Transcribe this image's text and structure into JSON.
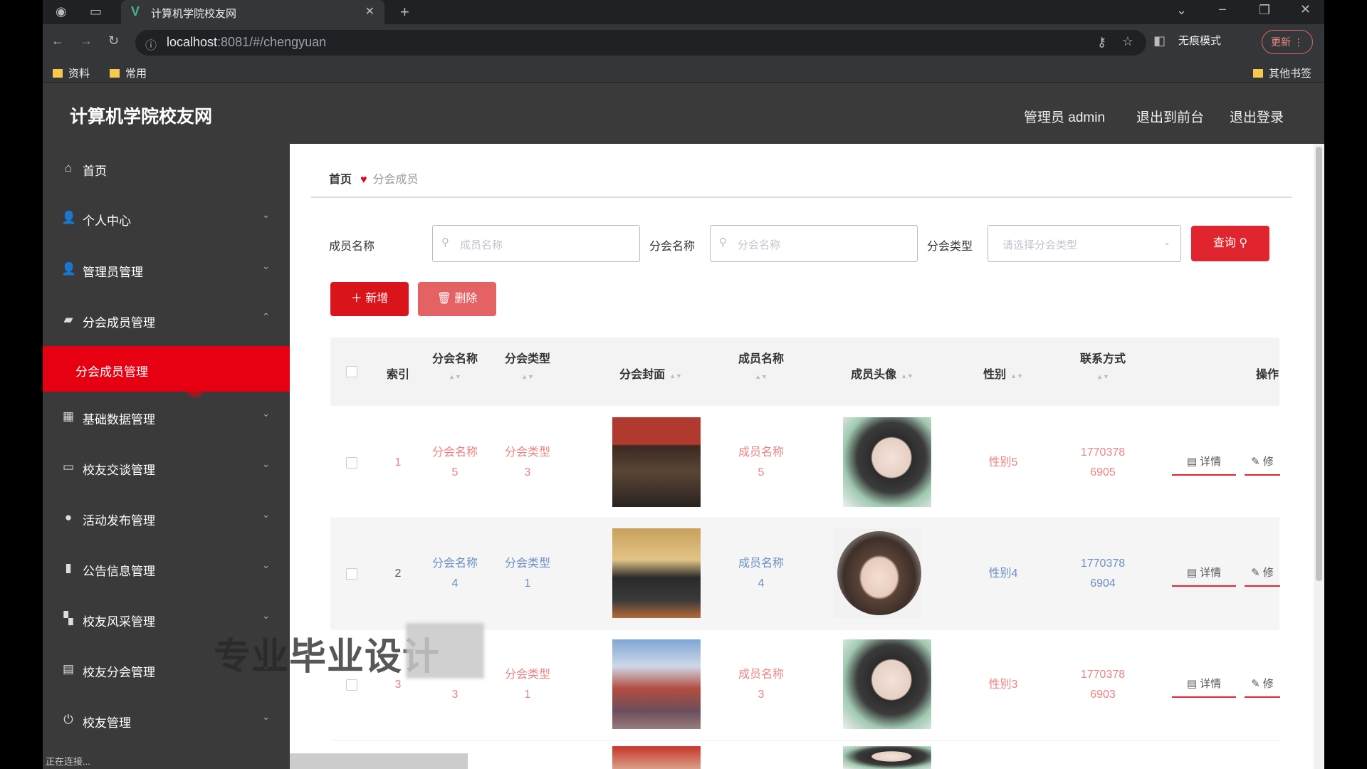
{
  "browser": {
    "tab_title": "计算机学院校友网",
    "tab_favicon": "V",
    "url_host": "localhost",
    "url_rest": ":8081/#/chengyuan",
    "incognito_label": "无痕模式",
    "update_label": "更新",
    "bookmarks": [
      "资料",
      "常用"
    ],
    "other_bookmarks": "其他书签"
  },
  "header": {
    "title": "计算机学院校友网",
    "admin_label": "管理员 admin",
    "front_label": "退出到前台",
    "logout_label": "退出登录"
  },
  "sidebar": {
    "items": [
      {
        "label": "首页",
        "icon": "home-icon"
      },
      {
        "label": "个人中心",
        "icon": "user-icon"
      },
      {
        "label": "管理员管理",
        "icon": "user-icon"
      },
      {
        "label": "分会成员管理",
        "icon": "briefcase-icon"
      },
      {
        "label": "基础数据管理",
        "icon": "table-icon"
      },
      {
        "label": "校友交谈管理",
        "icon": "chat-icon"
      },
      {
        "label": "活动发布管理",
        "icon": "pin-icon"
      },
      {
        "label": "公告信息管理",
        "icon": "chart-icon"
      },
      {
        "label": "校友风采管理",
        "icon": "grid-icon"
      },
      {
        "label": "校友分会管理",
        "icon": "clipboard-icon"
      },
      {
        "label": "校友管理",
        "icon": "power-icon"
      }
    ],
    "sub_active": "分会成员管理",
    "status": "正在连接..."
  },
  "breadcrumb": {
    "home": "首页",
    "current": "分会成员"
  },
  "search": {
    "member_label": "成员名称",
    "member_placeholder": "成员名称",
    "branch_label": "分会名称",
    "branch_placeholder": "分会名称",
    "type_label": "分会类型",
    "type_placeholder": "请选择分会类型",
    "query_label": "查询"
  },
  "actions": {
    "add_label": "新增",
    "delete_label": "删除"
  },
  "table": {
    "headers": {
      "index": "索引",
      "branch_name": "分会名称",
      "branch_type": "分会类型",
      "cover": "分会封面",
      "member_name": "成员名称",
      "avatar": "成员头像",
      "gender": "性别",
      "contact": "联系方式",
      "ops": "操作"
    },
    "rows": [
      {
        "index": "1",
        "branch_name_1": "分会名称",
        "branch_name_2": "5",
        "branch_type_1": "分会类型",
        "branch_type_2": "3",
        "member_1": "成员名称",
        "member_2": "5",
        "gender": "性别5",
        "contact_1": "1770378",
        "contact_2": "6905",
        "detail": "详情",
        "edit": "修",
        "color": "red"
      },
      {
        "index": "2",
        "branch_name_1": "分会名称",
        "branch_name_2": "4",
        "branch_type_1": "分会类型",
        "branch_type_2": "1",
        "member_1": "成员名称",
        "member_2": "4",
        "gender": "性别4",
        "contact_1": "1770378",
        "contact_2": "6904",
        "detail": "详情",
        "edit": "修",
        "color": "blue"
      },
      {
        "index": "3",
        "branch_name_1": "",
        "branch_name_2": "3",
        "branch_type_1": "分会类型",
        "branch_type_2": "1",
        "member_1": "成员名称",
        "member_2": "3",
        "gender": "性别3",
        "contact_1": "1770378",
        "contact_2": "6903",
        "detail": "详情",
        "edit": "修",
        "color": "red"
      }
    ]
  },
  "watermark": "专业毕业设计"
}
